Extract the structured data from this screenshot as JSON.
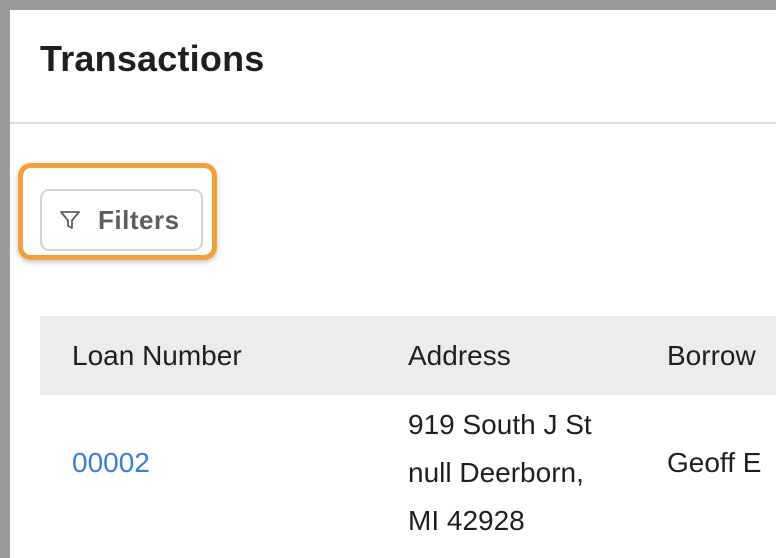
{
  "header": {
    "title": "Transactions"
  },
  "toolbar": {
    "filters_label": "Filters",
    "filters_icon": "filter-icon"
  },
  "table": {
    "columns": [
      "Loan Number",
      "Address",
      "Borrow"
    ],
    "rows": [
      {
        "loan_number": "00002",
        "address_lines": [
          "919 South J St",
          "null Deerborn,",
          "MI 42928"
        ],
        "borrower": "Geoff E"
      }
    ]
  },
  "colors": {
    "highlight": "#f0a03c",
    "link": "#3b7ddd",
    "header_bg": "#ececec"
  }
}
